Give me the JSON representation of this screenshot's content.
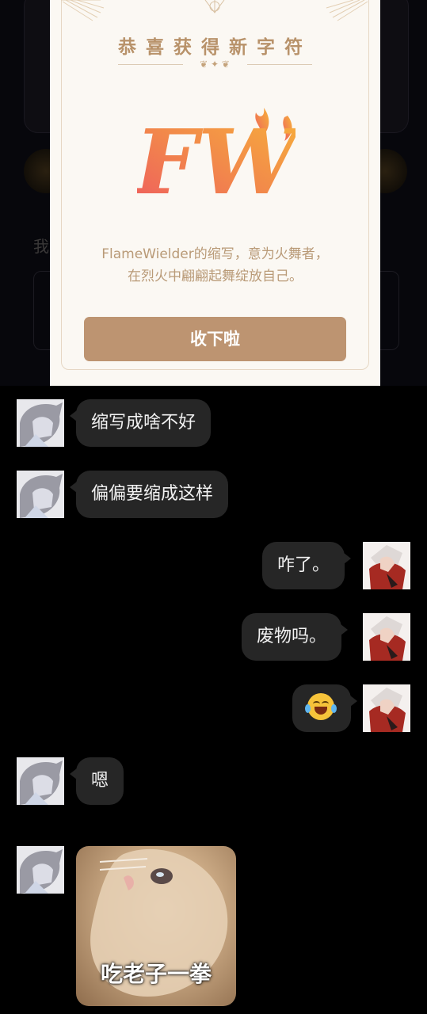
{
  "background": {
    "partial_text": "我"
  },
  "award_card": {
    "title": "恭喜获得新字符",
    "logo_text": "FW",
    "description_line1": "FlameWielder的缩写，意为火舞者，",
    "description_line2": "在烈火中翩翩起舞绽放自己。",
    "accept_button": "收下啦",
    "colors": {
      "accent": "#bd9471",
      "title": "#b8926a",
      "logo_start": "#f06a5a",
      "logo_end": "#f7a83a"
    }
  },
  "chat": {
    "messages": [
      {
        "side": "left",
        "text": "缩写成啥不好"
      },
      {
        "side": "left",
        "text": "偏偏要缩成这样"
      },
      {
        "side": "right",
        "text": "咋了。"
      },
      {
        "side": "right",
        "text": "废物吗。"
      },
      {
        "side": "right",
        "emoji": "face-with-tears-of-joy"
      },
      {
        "side": "left",
        "text": "嗯"
      },
      {
        "side": "left",
        "sticker_caption": "吃老子一拳"
      }
    ],
    "colors": {
      "bubble": "#262626",
      "background": "#000000"
    }
  }
}
